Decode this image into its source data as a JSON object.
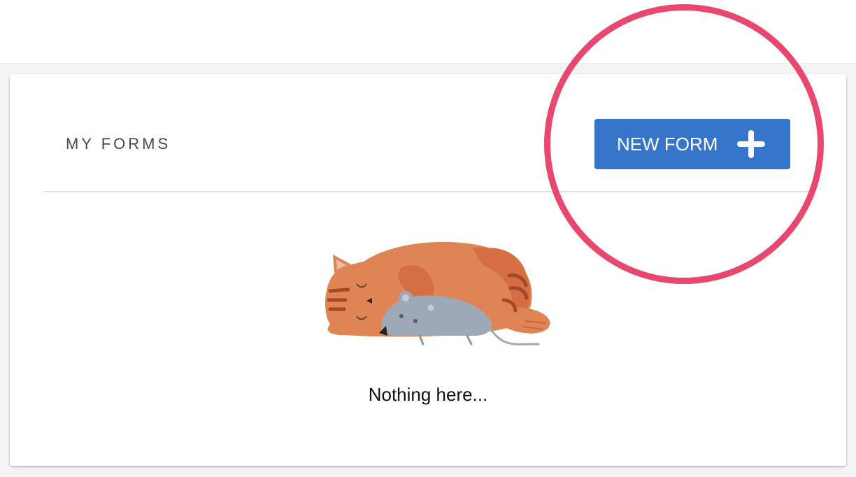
{
  "card": {
    "title": "MY FORMS",
    "new_form_label": "NEW FORM",
    "empty_message": "Nothing here..."
  },
  "icons": {
    "new_form": "plus-icon",
    "empty_state": "sleeping-cat-with-mouse-illustration"
  },
  "colors": {
    "primary_button": "#3576cb",
    "highlight_ring": "#e8486f",
    "cat": "#df8555",
    "mouse": "#9ea9b8"
  }
}
